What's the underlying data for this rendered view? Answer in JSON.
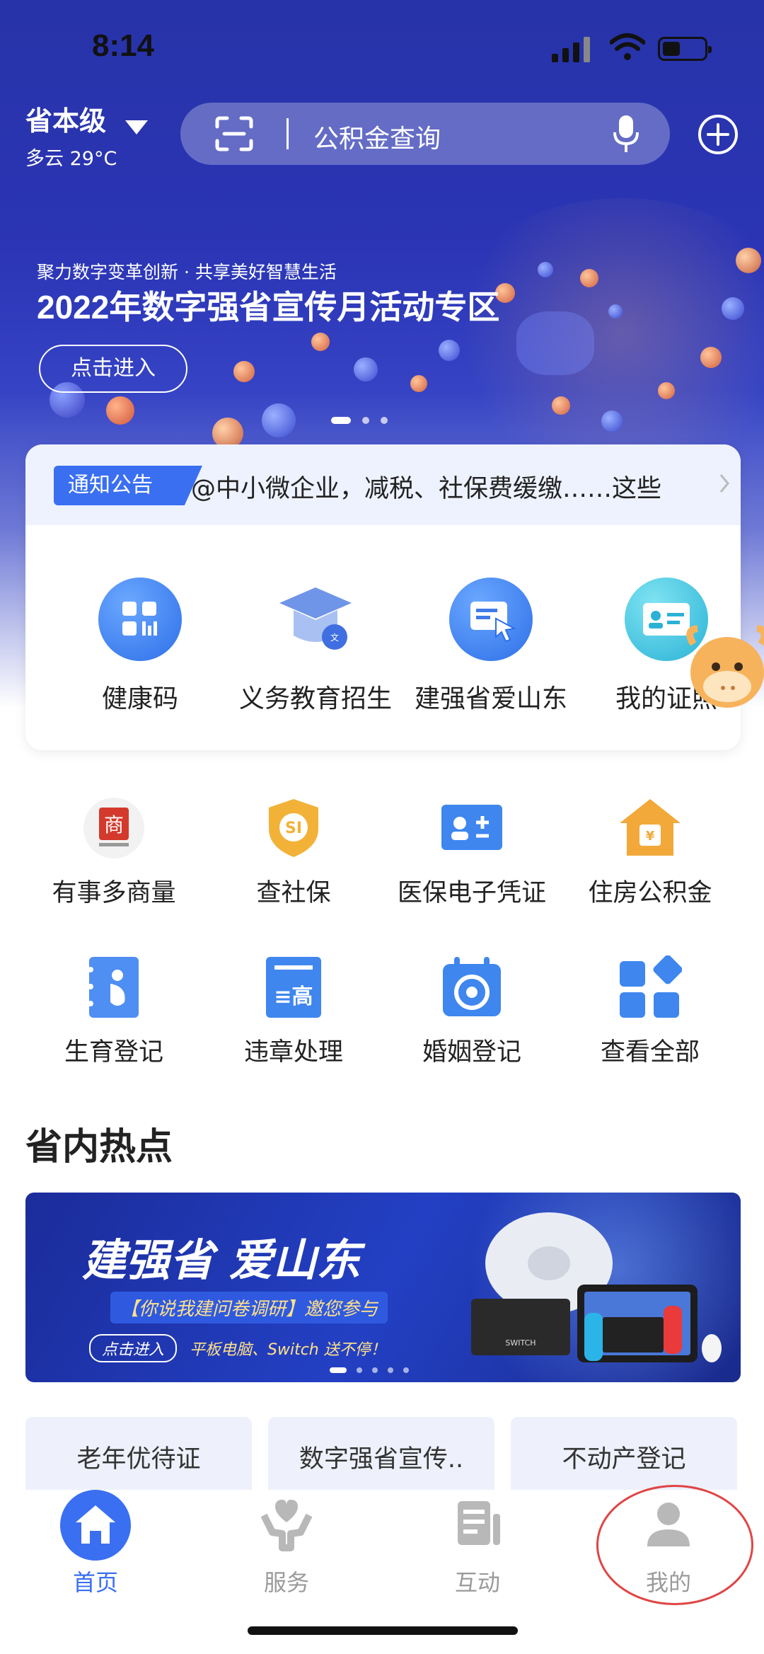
{
  "status": {
    "time": "8:14"
  },
  "location": {
    "name": "省本级",
    "weather": "多云 29°C"
  },
  "search": {
    "placeholder": "公积金查询"
  },
  "banner": {
    "subtitle": "聚力数字变革创新 · 共享美好智慧生活",
    "title": "2022年数字强省宣传月活动专区",
    "button": "点击进入"
  },
  "notice": {
    "tag": "通知公告",
    "text": "@中小微企业，减税、社保费缓缴……这些"
  },
  "top_services": [
    {
      "label": "健康码",
      "icon": "health-code-icon",
      "color": "#3b7cf0"
    },
    {
      "label": "义务教育招生",
      "icon": "graduation-cap-icon",
      "color": "#4a8ef5"
    },
    {
      "label": "建强省爱山东",
      "icon": "message-pointer-icon",
      "color": "#3b7cf0"
    },
    {
      "label": "我的证照",
      "icon": "id-card-icon",
      "color": "#3cb6e0"
    }
  ],
  "services": [
    {
      "label": "有事多商量",
      "icon": "seal-icon"
    },
    {
      "label": "查社保",
      "icon": "social-security-shield-icon"
    },
    {
      "label": "医保电子凭证",
      "icon": "medical-insurance-card-icon"
    },
    {
      "label": "住房公积金",
      "icon": "housing-fund-house-icon"
    },
    {
      "label": "生育登记",
      "icon": "pregnancy-notebook-icon"
    },
    {
      "label": "违章处理",
      "icon": "traffic-ticket-icon"
    },
    {
      "label": "婚姻登记",
      "icon": "marriage-calendar-icon"
    },
    {
      "label": "查看全部",
      "icon": "all-grid-icon"
    }
  ],
  "hot": {
    "title": "省内热点",
    "promo_title": "建强省 爱山东",
    "promo_sub": "【你说我建问卷调研】邀您参与",
    "promo_btn": "点击进入",
    "promo_note": "平板电脑、Switch 送不停！"
  },
  "chips": [
    "老年优待证",
    "数字强省宣传..",
    "不动产登记"
  ],
  "tabs": [
    {
      "label": "首页",
      "icon": "home-icon"
    },
    {
      "label": "服务",
      "icon": "heart-hand-icon"
    },
    {
      "label": "互动",
      "icon": "interaction-icon"
    },
    {
      "label": "我的",
      "icon": "user-icon"
    }
  ],
  "colors": {
    "accent": "#3a6ff2",
    "hero": "#2733a8",
    "highlight_circle": "#e04545"
  }
}
